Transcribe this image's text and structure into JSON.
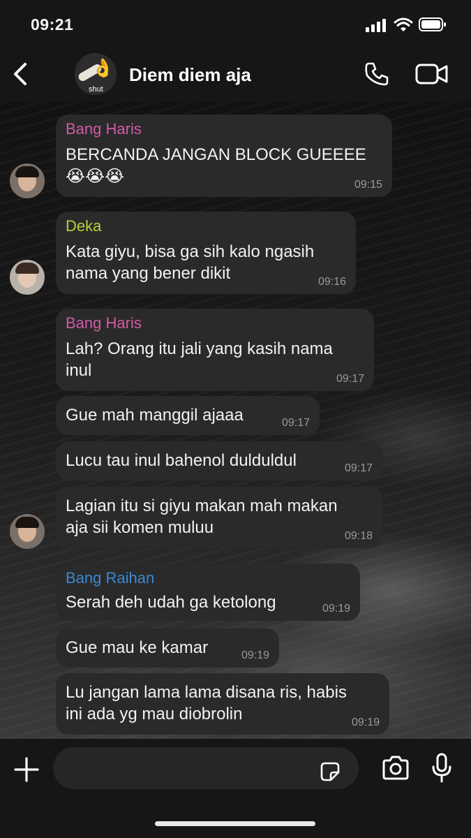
{
  "status_bar": {
    "time": "09:21",
    "battery_level": 0.9
  },
  "header": {
    "group_name": "Diem diem aja",
    "avatar_text": "shut",
    "avatar_emoji": "👌",
    "back_icon": "chevron-left-icon",
    "call_icon": "phone-icon",
    "video_icon": "video-camera-icon"
  },
  "messages": [
    {
      "sender": "Bang Haris",
      "sender_color": "#d35aa6",
      "text": "BERCANDA JANGAN BLOCK GUEEEE\n😭😭😭",
      "time": "09:15"
    },
    {
      "sender": "Deka",
      "sender_color": "#b7d33a",
      "text": "Kata giyu, bisa ga sih kalo ngasih\nnama yang bener dikit",
      "time": "09:16"
    },
    {
      "sender": "Bang Haris",
      "sender_color": "#d35aa6",
      "text": "Lah? Orang itu jali yang kasih nama\ninul",
      "time": "09:17"
    },
    {
      "sender": "",
      "text": "Gue mah manggil ajaaa",
      "time": "09:17"
    },
    {
      "sender": "",
      "text": "Lucu tau inul bahenol dulduldul",
      "time": "09:17"
    },
    {
      "sender": "",
      "text": "Lagian itu si giyu makan mah makan\naja sii komen muluu",
      "time": "09:18"
    },
    {
      "sender": "Bang Raihan",
      "sender_color": "#3a8ad3",
      "text": "Serah deh udah ga ketolong",
      "time": "09:19"
    },
    {
      "sender": "",
      "text": "Gue mau ke kamar",
      "time": "09:19"
    },
    {
      "sender": "",
      "text": "Lu jangan lama lama disana ris, habis\nini ada yg mau diobrolin",
      "time": "09:19"
    }
  ],
  "input_bar": {
    "placeholder": "",
    "plus_icon": "plus-icon",
    "sticker_icon": "sticker-icon",
    "camera_icon": "camera-icon",
    "mic_icon": "microphone-icon"
  }
}
